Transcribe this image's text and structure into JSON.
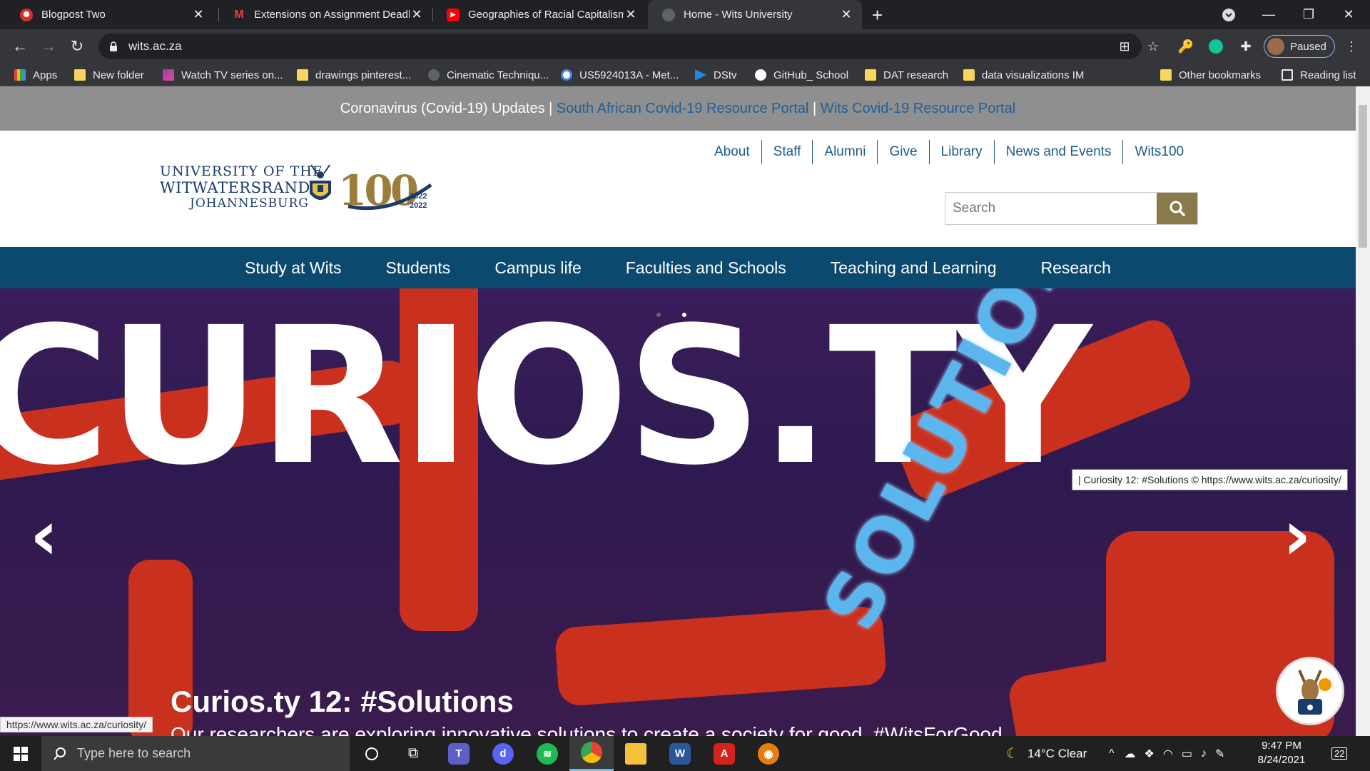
{
  "browser": {
    "tabs": [
      {
        "title": "Blogpost Two",
        "favicon": "blogger-icon",
        "active": false
      },
      {
        "title": "Extensions on Assignment Deadli",
        "favicon": "gmail-icon",
        "active": false
      },
      {
        "title": "Geographies of Racial Capitalism",
        "favicon": "youtube-icon",
        "active": false
      },
      {
        "title": "Home - Wits University",
        "favicon": "globe-icon",
        "active": true
      }
    ],
    "url": "wits.ac.za",
    "profile_label": "Paused",
    "bookmarks": [
      {
        "label": "Apps",
        "icon": "apps-grid-icon"
      },
      {
        "label": "New folder",
        "icon": "folder-icon"
      },
      {
        "label": "Watch TV series on...",
        "icon": "tv-icon"
      },
      {
        "label": "drawings pinterest...",
        "icon": "folder-icon"
      },
      {
        "label": "Cinematic Techniqu...",
        "icon": "link-icon"
      },
      {
        "label": "US5924013A - Met...",
        "icon": "google-icon"
      },
      {
        "label": "DStv",
        "icon": "dstv-icon"
      },
      {
        "label": "GitHub_ School",
        "icon": "github-icon"
      },
      {
        "label": "DAT research",
        "icon": "folder-icon"
      },
      {
        "label": "data visualizations IM",
        "icon": "folder-icon"
      },
      {
        "label": "Other bookmarks",
        "icon": "folder-icon"
      },
      {
        "label": "Reading list",
        "icon": "reading-list-icon"
      }
    ]
  },
  "page": {
    "covid": {
      "lead": "Coronavirus (Covid-19) Updates |",
      "link1": "South African Covid-19 Resource Portal",
      "sep": "|",
      "link2": "Wits Covid-19 Resource Portal"
    },
    "logo": {
      "line1": "UNIVERSITY OF THE",
      "line2": "WITWATERSRAND,",
      "line3": "JOHANNESBURG",
      "hundred": "100",
      "year_start": "1922",
      "year_end": "2022"
    },
    "util_nav": [
      "About",
      "Staff",
      "Alumni",
      "Give",
      "Library",
      "News and Events",
      "Wits100"
    ],
    "search_placeholder": "Search",
    "main_nav": [
      "Study at Wits",
      "Students",
      "Campus life",
      "Faculties and Schools",
      "Teaching and Learning",
      "Research"
    ],
    "hero": {
      "big_text": "CURIOS.TY",
      "solutions_text": "SOLUTIONS",
      "caption": "Curios.ty 12: #Solutions",
      "subcaption": "Our researchers are exploring innovative solutions to create a society for good. #WitsForGood",
      "tooltip": "| Curiosity 12: #Solutions © https://www.wits.ac.za/curiosity/"
    },
    "status_url": "https://www.wits.ac.za/curiosity/"
  },
  "taskbar": {
    "search_placeholder": "Type here to search",
    "weather": "14°C  Clear",
    "time": "9:47 PM",
    "date": "8/24/2021",
    "notifications": "22"
  },
  "colors": {
    "nav_blue": "#0b4a6e",
    "link_blue": "#1e5f9a",
    "gold": "#9b7e3c"
  }
}
